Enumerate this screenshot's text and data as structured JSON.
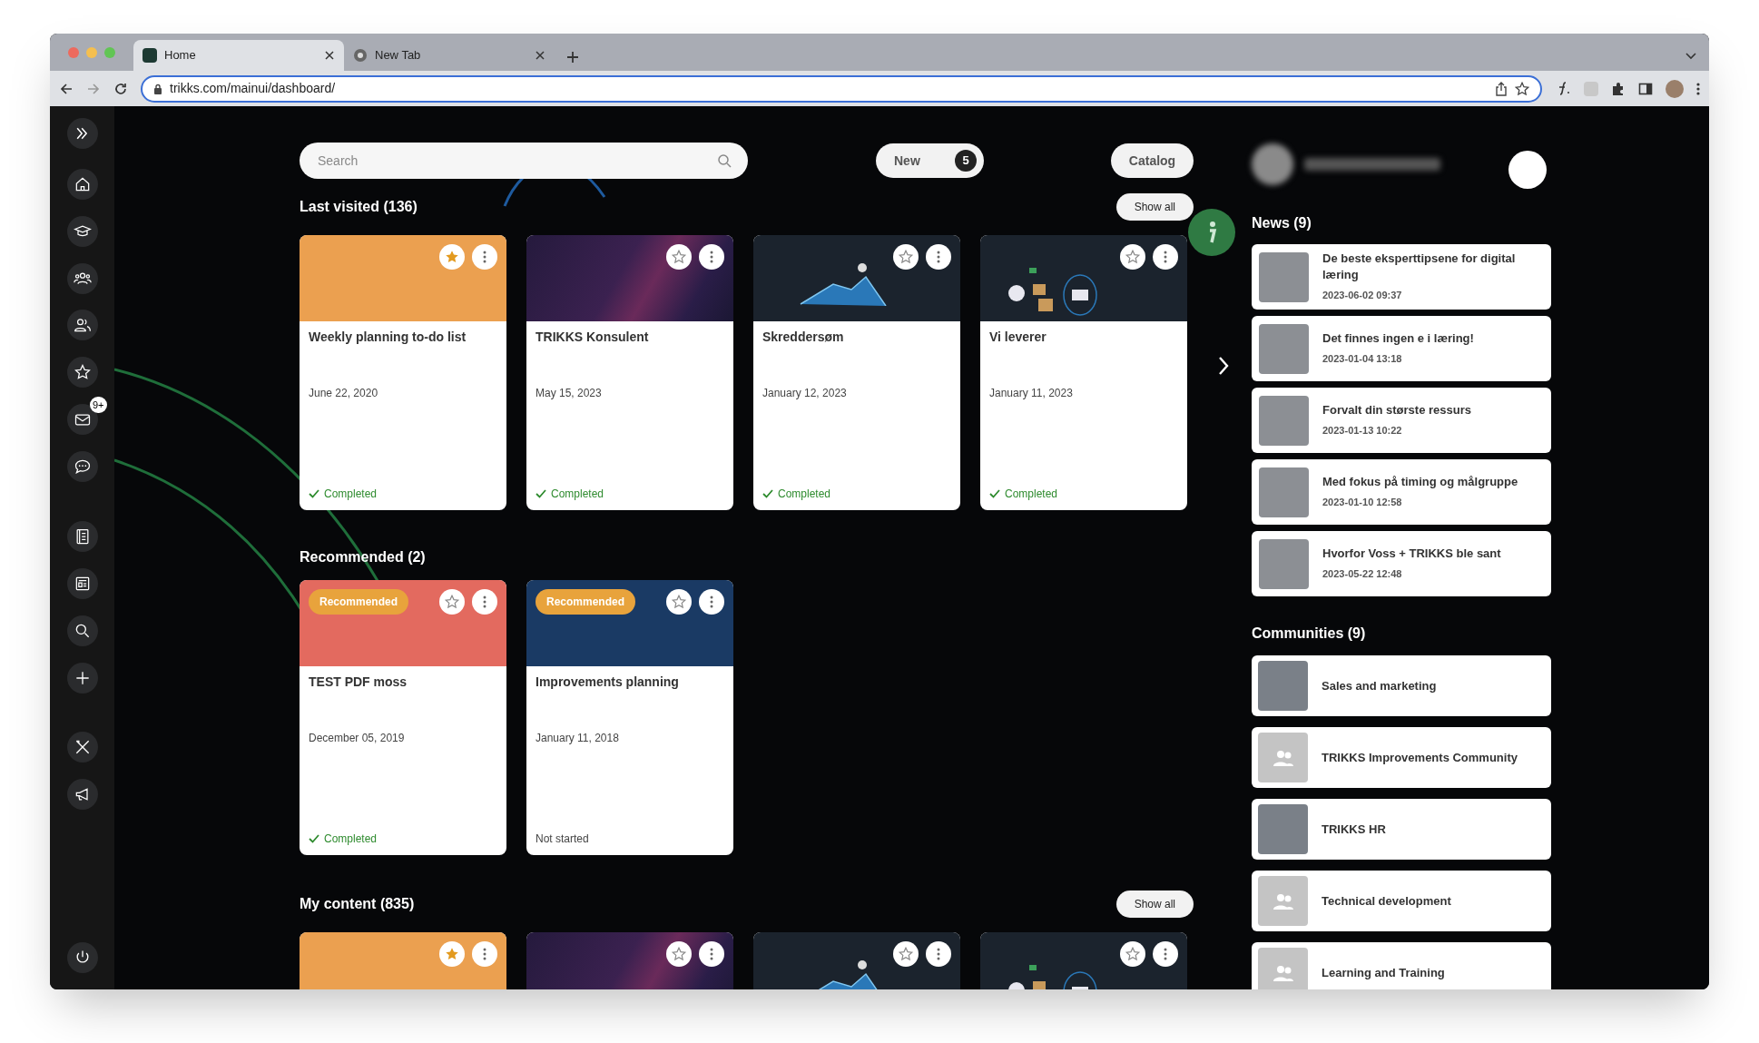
{
  "browser": {
    "tabs": [
      {
        "title": "Home",
        "selected": true
      },
      {
        "title": "New Tab",
        "selected": false
      }
    ],
    "url": "trikks.com/mainui/dashboard/"
  },
  "sidebar": {
    "mail_badge": "9+"
  },
  "header": {
    "search_placeholder": "Search",
    "new_button": {
      "label": "New",
      "count": "5"
    },
    "catalog_button": "Catalog"
  },
  "sections": [
    {
      "title": "Last visited (136)",
      "show_all": "Show all",
      "cards": [
        {
          "title": "Weekly planning to-do list",
          "date": "June 22, 2020",
          "status": "Completed",
          "completed": true,
          "favorite": true,
          "cover": {
            "kind": "solid",
            "color": "#eba050"
          }
        },
        {
          "title": "TRIKKS Konsulent",
          "date": "May 15, 2023",
          "status": "Completed",
          "completed": true,
          "favorite": false,
          "cover": {
            "kind": "gradient"
          }
        },
        {
          "title": "Skreddersøm",
          "date": "January 12, 2023",
          "status": "Completed",
          "completed": true,
          "favorite": false,
          "cover": {
            "kind": "mountain"
          }
        },
        {
          "title": "Vi leverer",
          "date": "January 11, 2023",
          "status": "Completed",
          "completed": true,
          "favorite": false,
          "cover": {
            "kind": "space"
          }
        }
      ]
    },
    {
      "title": "Recommended (2)",
      "cards": [
        {
          "badge": "Recommended",
          "title": "TEST PDF moss",
          "date": "December 05, 2019",
          "status": "Completed",
          "completed": true,
          "favorite": false,
          "cover": {
            "kind": "solid",
            "color": "#e36a5f"
          }
        },
        {
          "badge": "Recommended",
          "title": "Improvements planning",
          "date": "January 11, 2018",
          "status": "Not started",
          "completed": false,
          "favorite": false,
          "cover": {
            "kind": "solid",
            "color": "#1a3a64"
          }
        }
      ]
    },
    {
      "title": "My content (835)",
      "show_all": "Show all",
      "cards": [
        {
          "favorite": true,
          "cover": {
            "kind": "solid",
            "color": "#eba050"
          }
        },
        {
          "favorite": false,
          "cover": {
            "kind": "gradient"
          }
        },
        {
          "favorite": false,
          "cover": {
            "kind": "mountain"
          }
        },
        {
          "favorite": false,
          "cover": {
            "kind": "space"
          }
        }
      ]
    }
  ],
  "news": {
    "title": "News (9)",
    "items": [
      {
        "title": "De beste eksperttipsene for digital læring",
        "date": "2023-06-02 09:37"
      },
      {
        "title": "Det finnes ingen e i læring!",
        "date": "2023-01-04 13:18"
      },
      {
        "title": "Forvalt din største ressurs",
        "date": "2023-01-13 10:22"
      },
      {
        "title": "Med fokus på timing og målgruppe",
        "date": "2023-01-10 12:58"
      },
      {
        "title": "Hvorfor Voss + TRIKKS ble sant",
        "date": "2023-05-22 12:48"
      }
    ]
  },
  "communities": {
    "title": "Communities (9)",
    "items": [
      {
        "name": "Sales and marketing",
        "has_photo": true
      },
      {
        "name": "TRIKKS Improvements Community",
        "has_photo": false
      },
      {
        "name": "TRIKKS HR",
        "has_photo": true
      },
      {
        "name": "Technical development",
        "has_photo": false
      },
      {
        "name": "Learning and Training",
        "has_photo": false
      }
    ]
  }
}
